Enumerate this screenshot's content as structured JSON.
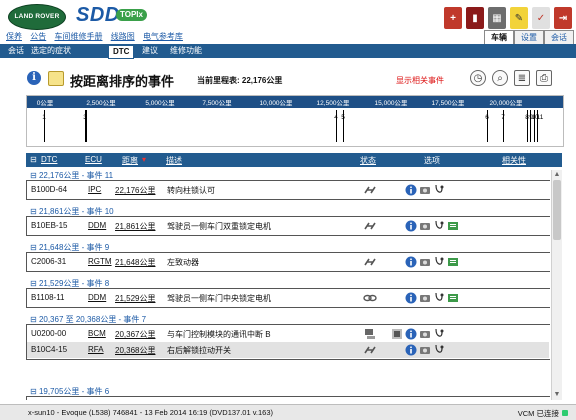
{
  "brand": {
    "lr_logo": "LAND ROVER",
    "sdd": "SDD",
    "topix": "TOPIx"
  },
  "nav_links": [
    "保养",
    "公告",
    "车间维修手册",
    "线路图",
    "电气参考库"
  ],
  "main_tabs": [
    {
      "label": "车辆",
      "active": true
    },
    {
      "label": "设置",
      "active": false
    },
    {
      "label": "会话",
      "active": false
    }
  ],
  "sub_tabs": [
    {
      "label": "会话",
      "active": false
    },
    {
      "label": "选定的症状",
      "active": false
    },
    {
      "label": "DTC",
      "active": true
    },
    {
      "label": "建议",
      "active": false
    },
    {
      "label": "维修功能",
      "active": false
    }
  ],
  "header": {
    "info_icon": "i",
    "title": "按距离排序的事件",
    "mileage": "当前里程表: 22,176公里",
    "related_link": "显示相关事件"
  },
  "timeline": {
    "ticks": [
      "0公里",
      "2,500公里",
      "5,000公里",
      "7,500公里",
      "10,000公里",
      "12,500公里",
      "15,000公里",
      "17,500公里",
      "20,000公里"
    ],
    "events": [
      "1",
      "2",
      "3",
      "4",
      "5",
      "6",
      "7",
      "8",
      "9",
      "10",
      "11"
    ]
  },
  "columns": {
    "dtc": "DTC",
    "ecu": "ECU",
    "distance": "距离",
    "description": "描述",
    "status": "状态",
    "options": "选项",
    "relevance": "相关性"
  },
  "groups": [
    {
      "title": "22,176公里 - 事件 11",
      "rows": [
        {
          "dtc": "B100D-64",
          "ecu": "IPC",
          "distance": "22,176公里",
          "desc": "转向柱锁认可"
        }
      ]
    },
    {
      "title": "21,861公里 - 事件 10",
      "rows": [
        {
          "dtc": "B10EB-15",
          "ecu": "DDM",
          "distance": "21,861公里",
          "desc": "驾驶员一侧车门双重锁定电机"
        }
      ]
    },
    {
      "title": "21,648公里 - 事件 9",
      "rows": [
        {
          "dtc": "C2006-31",
          "ecu": "RGTM",
          "distance": "21,648公里",
          "desc": "左致动器"
        }
      ]
    },
    {
      "title": "21,529公里 - 事件 8",
      "rows": [
        {
          "dtc": "B1108-11",
          "ecu": "DDM",
          "distance": "21,529公里",
          "desc": "驾驶员一侧车门中央锁定电机"
        }
      ]
    },
    {
      "title": "20,367 至 20,368公里 - 事件 7",
      "rows": [
        {
          "dtc": "U0200-00",
          "ecu": "BCM",
          "distance": "20,367公里",
          "desc": "与车门控制模块的通讯中断 B"
        },
        {
          "dtc": "B10C4-15",
          "ecu": "RFA",
          "distance": "20,368公里",
          "desc": "右后解锁拉动开关"
        }
      ]
    },
    {
      "title": "19,705公里 - 事件 6",
      "rows": []
    }
  ],
  "status_bar": {
    "left": "x-sun10 - Evoque (L538) 746841 - 13 Feb 2014 16:19 (DVD137.01 v.163)",
    "right": "VCM 已连接"
  }
}
